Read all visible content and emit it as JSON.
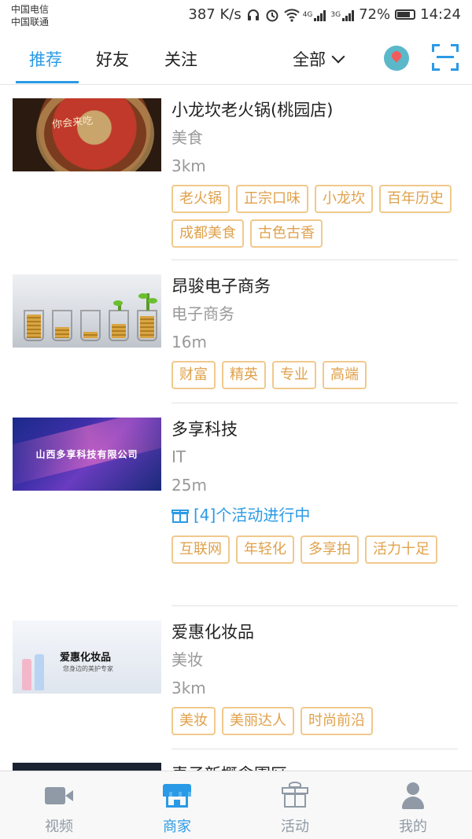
{
  "status_bar": {
    "carrier_1": "中国电信",
    "carrier_2": "中国联通",
    "net_speed": "387 K/s",
    "network_1": "4G",
    "network_2": "3G",
    "battery": "72%",
    "time": "14:24"
  },
  "top_tabs": {
    "tabs": [
      {
        "label": "推荐",
        "active": true
      },
      {
        "label": "好友",
        "active": false
      },
      {
        "label": "关注",
        "active": false
      }
    ],
    "filter_label": "全部",
    "location_icon": "map-pin-icon",
    "scan_icon": "scan-icon"
  },
  "merchants": [
    {
      "name": "小龙坎老火锅(桃园店)",
      "category": "美食",
      "distance": "3km",
      "thumb_text": "你会来吃",
      "tags": [
        "老火锅",
        "正宗口味",
        "小龙坎",
        "百年历史",
        "成都美食",
        "古色古香"
      ]
    },
    {
      "name": "昂骏电子商务",
      "category": "电子商务",
      "distance": "16m",
      "tags": [
        "财富",
        "精英",
        "专业",
        "高端"
      ]
    },
    {
      "name": "多享科技",
      "category": "IT",
      "distance": "25m",
      "thumb_text": "山西多享科技有限公司",
      "activity": "[4]个活动进行中",
      "tags": [
        "互联网",
        "年轻化",
        "多享拍",
        "活力十足"
      ]
    },
    {
      "name": "爱惠化妆品",
      "category": "美妆",
      "distance": "3km",
      "thumb_text": "爱惠化妆品",
      "thumb_subtext": "您身边的美护专家",
      "tags": [
        "美妆",
        "美丽达人",
        "时尚前沿"
      ]
    },
    {
      "name": "麦子新概念園区"
    }
  ],
  "bottom_nav": [
    {
      "label": "视频",
      "icon": "video-camera-icon",
      "active": false
    },
    {
      "label": "商家",
      "icon": "store-icon",
      "active": true
    },
    {
      "label": "活动",
      "icon": "gift-icon",
      "active": false
    },
    {
      "label": "我的",
      "icon": "user-icon",
      "active": false
    }
  ],
  "colors": {
    "accent": "#2a9ae6",
    "tag_text": "#e0a14b",
    "tag_border": "#f0c98c",
    "muted": "#999999"
  }
}
